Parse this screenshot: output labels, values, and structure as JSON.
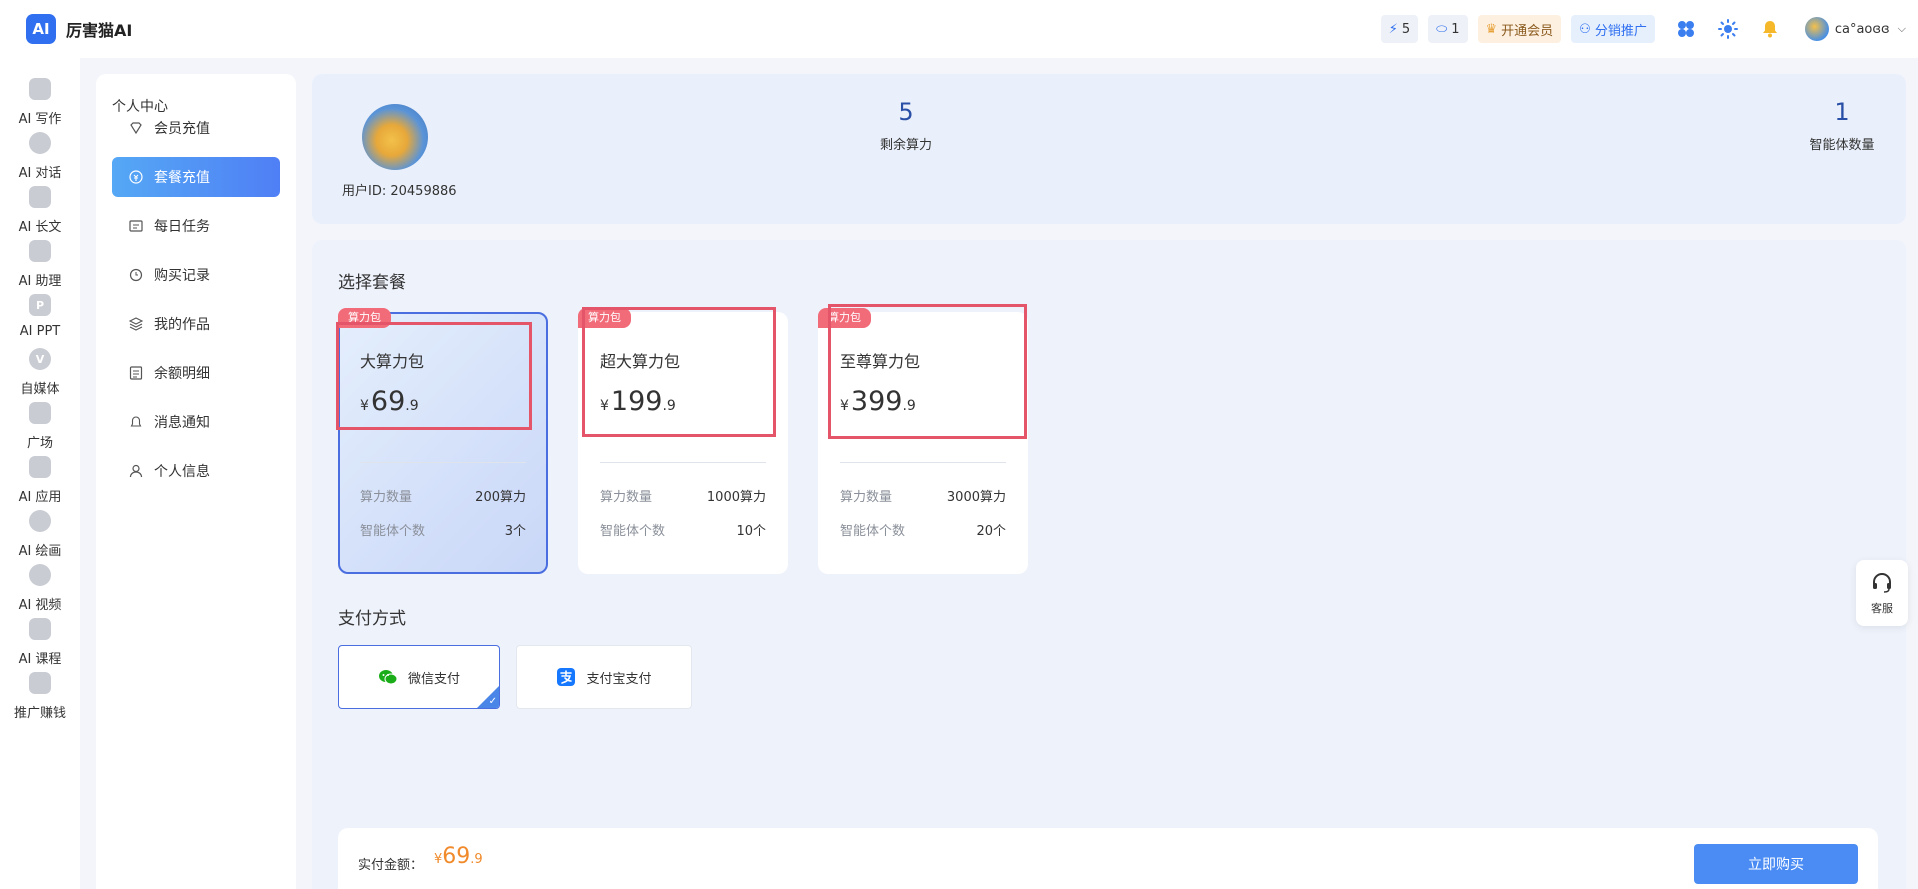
{
  "app": {
    "logo": "AI",
    "name": "厉害猫AI"
  },
  "header": {
    "energy": "5",
    "chat_count": "1",
    "vip_label": "开通会员",
    "distribution_label": "分销推广",
    "username": "ca°aoɞɞ"
  },
  "rail": [
    {
      "label": "AI 写作",
      "icon": "pencil-icon"
    },
    {
      "label": "AI 对话",
      "icon": "chat-icon"
    },
    {
      "label": "AI 长文",
      "icon": "document-icon"
    },
    {
      "label": "AI 助理",
      "icon": "assistant-icon"
    },
    {
      "label": "AI PPT",
      "icon": "ppt-icon",
      "glyph": "P"
    },
    {
      "label": "自媒体",
      "icon": "media-icon",
      "glyph": "V"
    },
    {
      "label": "广场",
      "icon": "grid-icon"
    },
    {
      "label": "AI 应用",
      "icon": "app-icon"
    },
    {
      "label": "AI 绘画",
      "icon": "palette-icon"
    },
    {
      "label": "AI 视频",
      "icon": "play-icon"
    },
    {
      "label": "AI 课程",
      "icon": "graduation-icon"
    },
    {
      "label": "推广赚钱",
      "icon": "money-icon"
    }
  ],
  "menu": {
    "title": "个人中心",
    "items": [
      {
        "label": "会员充值",
        "icon": "diamond-icon"
      },
      {
        "label": "套餐充值",
        "icon": "coin-icon",
        "active": true
      },
      {
        "label": "每日任务",
        "icon": "task-icon"
      },
      {
        "label": "购买记录",
        "icon": "history-icon"
      },
      {
        "label": "我的作品",
        "icon": "layers-icon"
      },
      {
        "label": "余额明细",
        "icon": "list-icon"
      },
      {
        "label": "消息通知",
        "icon": "bell-icon"
      },
      {
        "label": "个人信息",
        "icon": "user-icon"
      }
    ]
  },
  "profile": {
    "user_id": "用户ID: 20459886",
    "remaining_compute": {
      "value": "5",
      "label": "剩余算力"
    },
    "agent_count": {
      "value": "1",
      "label": "智能体数量"
    }
  },
  "packages": {
    "title": "选择套餐",
    "items": [
      {
        "tag": "算力包",
        "name": "大算力包",
        "currency": "¥",
        "price_int": "69",
        "price_dec": ".9",
        "compute_label": "算力数量",
        "compute_value": "200算力",
        "agent_label": "智能体个数",
        "agent_value": "3个",
        "selected": true
      },
      {
        "tag": "算力包",
        "name": "超大算力包",
        "currency": "¥",
        "price_int": "199",
        "price_dec": ".9",
        "compute_label": "算力数量",
        "compute_value": "1000算力",
        "agent_label": "智能体个数",
        "agent_value": "10个"
      },
      {
        "tag": "算力包",
        "name": "至尊算力包",
        "currency": "¥",
        "price_int": "399",
        "price_dec": ".9",
        "compute_label": "算力数量",
        "compute_value": "3000算力",
        "agent_label": "智能体个数",
        "agent_value": "20个"
      }
    ]
  },
  "payment": {
    "title": "支付方式",
    "methods": [
      {
        "label": "微信支付",
        "icon": "wechat-icon",
        "color": "#1aad19",
        "selected": true
      },
      {
        "label": "支付宝支付",
        "icon": "alipay-icon",
        "color": "#1677ff"
      }
    ]
  },
  "footer": {
    "amount_label": "实付金额：",
    "currency": "¥",
    "amount_int": "69",
    "amount_dec": ".9",
    "buy_label": "立即购买"
  },
  "support": {
    "label": "客服"
  },
  "colors": {
    "accent": "#4a8cf4",
    "highlight": "#e5556a",
    "tag": "#f26b79",
    "price": "#f08a2a"
  }
}
